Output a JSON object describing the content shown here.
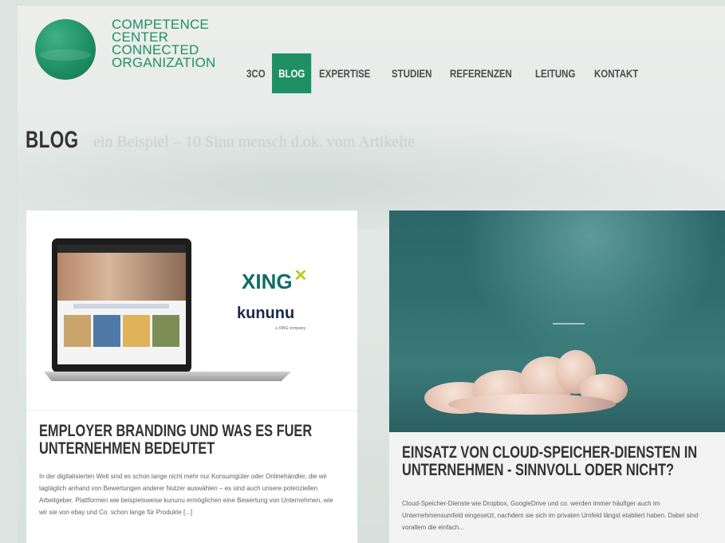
{
  "logo": {
    "lines": [
      "COMPETENCE",
      "CENTER",
      "CONNECTED",
      "ORGANIZATION"
    ]
  },
  "nav": {
    "items": [
      "3CO",
      "BLOG",
      "EXPERTISE",
      "STUDIEN",
      "REFERENZEN",
      "LEITUNG",
      "KONTAKT"
    ],
    "active": "BLOG"
  },
  "page": {
    "title": "BLOG",
    "tagline": "ein Beispiel – 10 Sinn mensch d.ok. vom Artikelte"
  },
  "posts": [
    {
      "title": "EMPLOYER BRANDING UND WAS ES FUER UNTERNEHMEN BEDEUTET",
      "image": {
        "brand1": "XING",
        "brand2": "kununu",
        "brand2_sub": "a XING company"
      },
      "excerpt": "In der digitalisierten Welt sind es schon lange nicht mehr nur Konsumgüter oder Onlinehändler, die wir tagtäglich anhand von Bewertungen anderer Nutzer auswählen – es sind auch unsere potenziellen Arbeitgeber. Plattformen wie beispielsweise kununu ermöglichen eine Bewertung von Unternehmen, wie wir sie von ebay und Co. schon lange für Produkte [...]"
    },
    {
      "title": "EINSATZ VON CLOUD-SPEICHER-DIENSTEN IN UNTERNEHMEN - SINNVOLL ODER NICHT?",
      "excerpt": "Cloud-Speicher-Dienste wie Dropbox, GoogleDrive und co. werden immer häufiger auch im Unternehmensumfeld eingesetzt, nachdem sie sich im privaten Umfeld längst etabliert haben. Dabei sind vorallem die einfach..."
    }
  ],
  "colors": {
    "brand_green": "#1f8f66",
    "nav_text": "#4b4b4b",
    "title_text": "#333333"
  }
}
